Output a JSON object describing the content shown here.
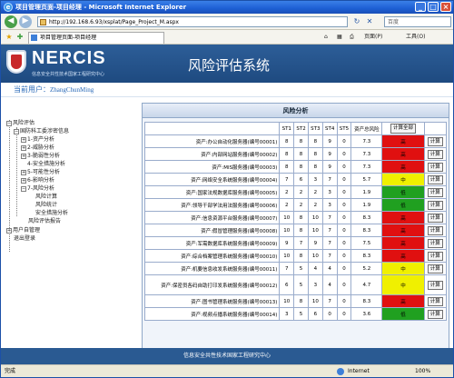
{
  "window": {
    "title": "项目管理页面-项目经理 - Microsoft Internet Explorer"
  },
  "browser": {
    "url": "http://192.168.6.93/xsplat/Page_Project_M.aspx",
    "search_placeholder": "百度",
    "tab_title": "项目管理页面-项目经理",
    "page_menu": "页面(P)",
    "tools_menu": "工具(O)"
  },
  "header": {
    "logo": "NERCIS",
    "logo_subtitle": "信息安全共性技术国家工程研究中心",
    "system_title": "风险评估系统",
    "user_label": "当前用户：",
    "user_name": "ZhangChunMing"
  },
  "sidebar": {
    "root": "风险评估",
    "org": "国防科工委涉密信息",
    "items": [
      "1-资产分析",
      "2-威胁分析",
      "3-脆弱性分析",
      "4-安全措施分析",
      "5-可能性分析",
      "6-影响分析",
      "7-风险分析"
    ],
    "subitems": [
      "风险计算",
      "风险统计",
      "安全措施分析"
    ],
    "report": "风险评估报告",
    "user_mgmt": "用户自管理",
    "logout": "退出登录"
  },
  "content": {
    "title": "风险分析",
    "columns": [
      "ST1",
      "ST2",
      "ST3",
      "ST4",
      "ST5",
      "资产总风险"
    ],
    "calc_all": "计算全部",
    "calc": "计算",
    "colors": {
      "high": "#e01010",
      "medium": "#f0f000",
      "low": "#20a020"
    },
    "rows": [
      {
        "name": "资产:办公自动化服务器(编号00001)",
        "st": [
          "8",
          "8",
          "8",
          "9",
          "0"
        ],
        "total": "7.3",
        "level": "高",
        "color": "high"
      },
      {
        "name": "资产:内部网站服务器(编号00002)",
        "st": [
          "8",
          "8",
          "8",
          "9",
          "0"
        ],
        "total": "7.3",
        "level": "高",
        "color": "high"
      },
      {
        "name": "资产:MIS服务器(编号00003)",
        "st": [
          "8",
          "8",
          "8",
          "9",
          "0"
        ],
        "total": "7.3",
        "level": "高",
        "color": "high"
      },
      {
        "name": "资产:网络安全系统服务器(编号00004)",
        "st": [
          "7",
          "6",
          "3",
          "7",
          "0"
        ],
        "total": "5.7",
        "level": "中",
        "color": "medium"
      },
      {
        "name": "资产:国家法规数据库服务器(编号00005)",
        "st": [
          "2",
          "2",
          "2",
          "3",
          "0"
        ],
        "total": "1.9",
        "level": "低",
        "color": "low"
      },
      {
        "name": "资产:领导干部学法用法服务器(编号00006)",
        "st": [
          "2",
          "2",
          "2",
          "3",
          "0"
        ],
        "total": "1.9",
        "level": "低",
        "color": "low"
      },
      {
        "name": "资产:信息资源平台服务器(编号00007)",
        "st": [
          "10",
          "8",
          "10",
          "7",
          "0"
        ],
        "total": "8.3",
        "level": "高",
        "color": "high"
      },
      {
        "name": "资产:假冒管理服务器(编号00008)",
        "st": [
          "10",
          "8",
          "10",
          "7",
          "0"
        ],
        "total": "8.3",
        "level": "高",
        "color": "high"
      },
      {
        "name": "资产:军需数据库系统服务器(编号00009)",
        "st": [
          "9",
          "7",
          "9",
          "7",
          "0"
        ],
        "total": "7.5",
        "level": "高",
        "color": "high"
      },
      {
        "name": "资产:综合档案管理系统服务器(编号00010)",
        "st": [
          "10",
          "8",
          "10",
          "7",
          "0"
        ],
        "total": "8.3",
        "level": "高",
        "color": "high"
      },
      {
        "name": "资产:机要信息收发系统服务器(编号00011)",
        "st": [
          "7",
          "5",
          "4",
          "4",
          "0"
        ],
        "total": "5.2",
        "level": "中",
        "color": "medium"
      },
      {
        "name": "资产:保密员各码自助打印发系统服务器(编号00012)",
        "st": [
          "6",
          "5",
          "3",
          "4",
          "0"
        ],
        "total": "4.7",
        "level": "中",
        "color": "medium"
      },
      {
        "name": "资产:图书管理系统服务器(编号00013)",
        "st": [
          "10",
          "8",
          "10",
          "7",
          "0"
        ],
        "total": "8.3",
        "level": "高",
        "color": "high"
      },
      {
        "name": "资产:视频点播系统服务器(编号00014)",
        "st": [
          "3",
          "5",
          "6",
          "0",
          "0"
        ],
        "total": "3.6",
        "level": "低",
        "color": "low"
      }
    ]
  },
  "footer": {
    "text": "信息安全共性技术国家工程研究中心"
  },
  "status": {
    "done": "完成",
    "zone": "Internet",
    "zoom": "100%"
  }
}
